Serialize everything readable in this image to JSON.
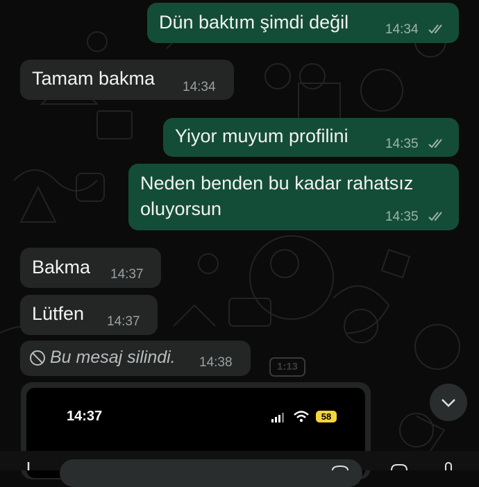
{
  "messages": [
    {
      "text": "Dün baktım şimdi değil",
      "time": "14:34",
      "direction": "outgoing",
      "read": true
    },
    {
      "text": "Tamam bakma",
      "time": "14:34",
      "direction": "incoming"
    },
    {
      "text": "Yiyor muyum profilini",
      "time": "14:35",
      "direction": "outgoing",
      "read": true
    },
    {
      "text_line1": "Neden benden bu kadar rahatsız",
      "text_line2": "oluyorsun",
      "time": "14:35",
      "direction": "outgoing",
      "read": true
    },
    {
      "text": "Bakma",
      "time": "14:37",
      "direction": "incoming"
    },
    {
      "text": "Lütfen",
      "time": "14:37",
      "direction": "incoming"
    },
    {
      "text": "Bu mesaj silindi.",
      "time": "14:38",
      "direction": "incoming",
      "deleted": true
    }
  ],
  "image_attachment": {
    "status_time": "14:37",
    "battery": "58"
  },
  "wallpaper_badge": "1:13",
  "icons": {
    "ticks": "double-check-icon",
    "deleted": "no-entry-icon",
    "scroll": "chevron-down-icon"
  },
  "colors": {
    "outgoing_bubble": "#144d37",
    "incoming_bubble": "#242626",
    "background": "#0b0b0b"
  }
}
